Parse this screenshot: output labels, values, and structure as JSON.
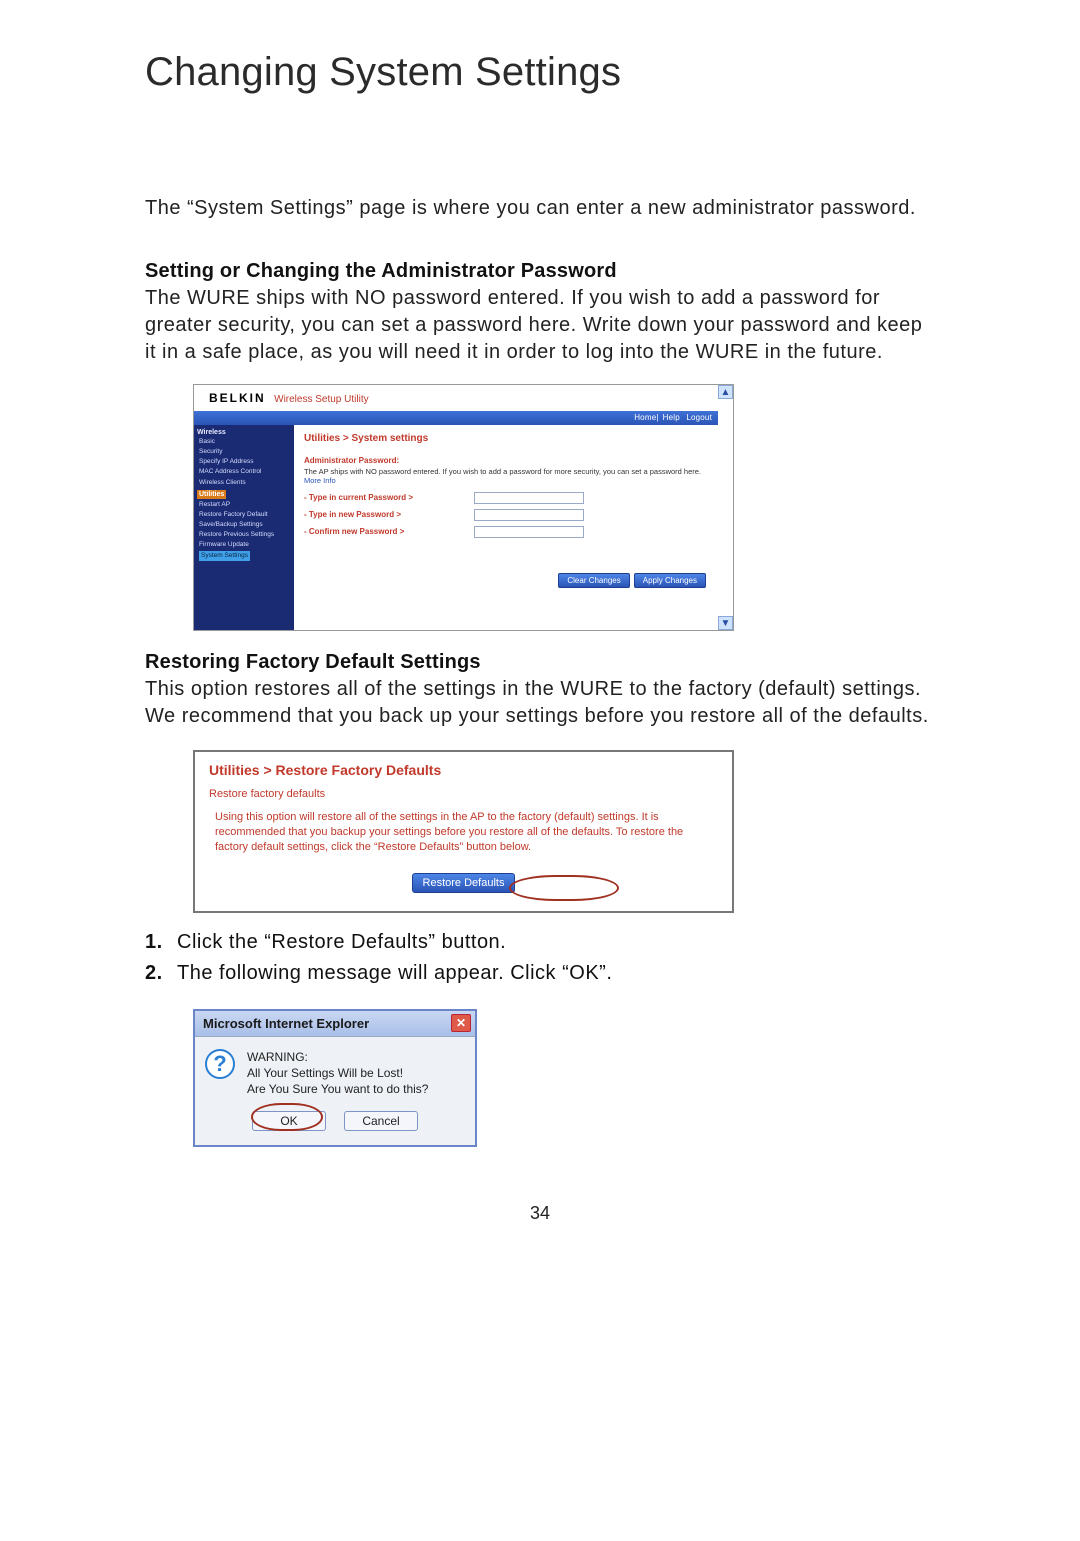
{
  "page_title": "Changing System Settings",
  "intro": "The “System Settings” page is where you can enter a new administrator password.",
  "section1": {
    "heading": "Setting or Changing the Administrator Password",
    "body": "The WURE ships with NO password entered. If you wish to add a password for greater security, you can set a password here. Write down your password and keep it in a safe place, as you will need it in order to log into the WURE in the future."
  },
  "shot1": {
    "brand": "BELKIN",
    "brand_sub": "Wireless Setup Utility",
    "topnav": {
      "home": "Home",
      "help": "Help",
      "logout": "Logout"
    },
    "sidebar": {
      "group_wireless": "Wireless",
      "items_wireless": [
        "Basic",
        "Security",
        "Specify IP Address",
        "MAC Address Control",
        "Wireless Clients"
      ],
      "group_utilities": "Utilities",
      "items_utilities": [
        "Restart AP",
        "Restore Factory Default",
        "Save/Backup Settings",
        "Restore Previous Settings",
        "Firmware Update",
        "System Settings"
      ]
    },
    "crumb": "Utilities > System settings",
    "admin_label": "Administrator Password:",
    "admin_desc": "The AP ships with NO password entered. If you wish to add a password for more security, you can set a password here. ",
    "more_info": "More Info",
    "row1": "- Type in current Password >",
    "row2": "- Type in new Password >",
    "row3": "- Confirm new Password >",
    "btn_clear": "Clear Changes",
    "btn_apply": "Apply Changes",
    "scroll_up": "▲",
    "scroll_dn": "▼"
  },
  "section2": {
    "heading": "Restoring Factory Default Settings",
    "body": "This option restores all of the settings in the WURE to the factory (default) settings. We recommend that you back up your settings before you restore all of the defaults."
  },
  "shot2": {
    "crumb": "Utilities > Restore Factory Defaults",
    "sub": "Restore factory defaults",
    "desc": "Using this option will restore all of the settings in the AP to the factory (default) settings. It is recommended that you backup your settings before you restore all of the defaults. To restore the factory default settings, click the “Restore Defaults” button below.",
    "btn": "Restore Defaults"
  },
  "steps": {
    "n1": "1.",
    "t1": "Click the “Restore Defaults” button.",
    "n2": "2.",
    "t2": "The following message will appear. Click “OK”."
  },
  "shot3": {
    "title": "Microsoft Internet Explorer",
    "close": "✕",
    "q": "?",
    "line1": "WARNING:",
    "line2": "All Your Settings Will be Lost!",
    "line3": "Are You Sure You want to do this?",
    "ok": "OK",
    "cancel": "Cancel"
  },
  "page_number": "34"
}
